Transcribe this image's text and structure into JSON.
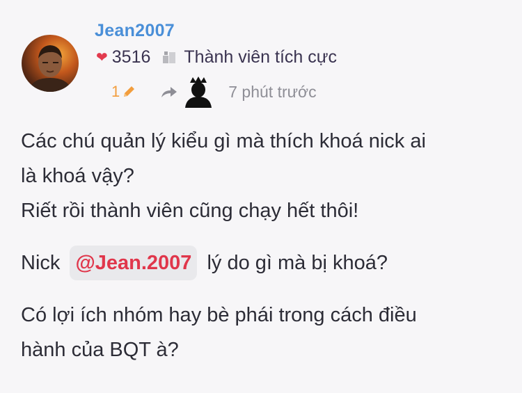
{
  "author": {
    "username": "Jean2007",
    "reputation": "3516",
    "rank": "Thành viên tích cực"
  },
  "meta": {
    "edit_count": "1",
    "time": "7 phút trước"
  },
  "content": {
    "line1": "Các chú quản lý kiểu gì mà thích khoá nick ai",
    "line2": "là khoá vậy?",
    "line3": "Riết rồi thành viên cũng chạy hết thôi!",
    "line4_before": "Nick",
    "mention": "@Jean.2007",
    "line4_after": "lý do gì mà bị khoá?",
    "line5": "Có lợi ích nhóm hay bè phái trong cách điều",
    "line6": "hành của BQT à?"
  },
  "colors": {
    "username": "#4a8fd8",
    "heart": "#e23a4e",
    "edit": "#f29d3d",
    "mention_text": "#e0364b",
    "mention_bg": "#e9e9ec"
  },
  "icons": [
    "heart-icon",
    "rank-icon",
    "pencil-icon",
    "share-icon",
    "crown-avatar-icon"
  ]
}
